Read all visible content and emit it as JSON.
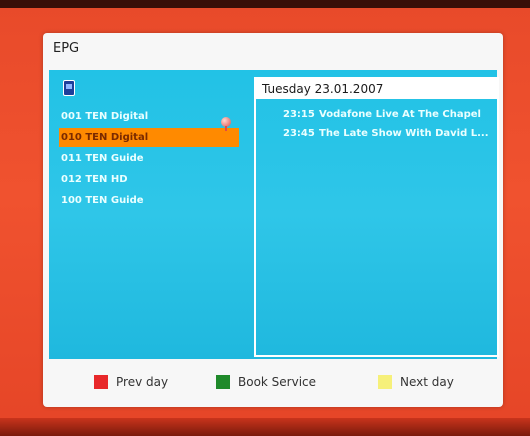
{
  "window": {
    "title": "EPG"
  },
  "channel_list": {
    "items": [
      {
        "label": "001 TEN Digital"
      },
      {
        "label": "010 TEN Digital"
      },
      {
        "label": "011 TEN Guide"
      },
      {
        "label": "012 TEN HD"
      },
      {
        "label": "100 TEN Guide"
      }
    ],
    "selected_index": 1
  },
  "events": {
    "date": "Tuesday 23.01.2007",
    "items": [
      {
        "time": "23:15",
        "title": "Vodafone Live At The Chapel"
      },
      {
        "time": "23:45",
        "title": "The Late Show With David L..."
      }
    ]
  },
  "footer": {
    "keys": [
      {
        "label": "Prev day",
        "color": "#e8282a"
      },
      {
        "label": "Book Service",
        "color": "#1f8a2a"
      },
      {
        "label": "Next day",
        "color": "#f6f07a"
      }
    ]
  },
  "icons": {
    "tv": "tv-icon",
    "favorite": "balloon-icon"
  }
}
